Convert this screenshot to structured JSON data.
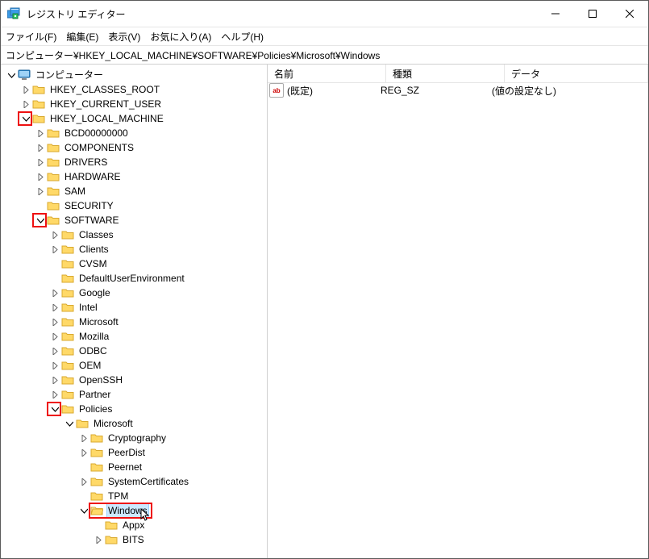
{
  "window": {
    "title": "レジストリ エディター"
  },
  "menu": {
    "file": "ファイル(F)",
    "edit": "編集(E)",
    "view": "表示(V)",
    "favorites": "お気に入り(A)",
    "help": "ヘルプ(H)"
  },
  "address": "コンピューター¥HKEY_LOCAL_MACHINE¥SOFTWARE¥Policies¥Microsoft¥Windows",
  "tree": {
    "root": "コンピューター",
    "hkcr": "HKEY_CLASSES_ROOT",
    "hkcu": "HKEY_CURRENT_USER",
    "hklm": "HKEY_LOCAL_MACHINE",
    "bcd": "BCD00000000",
    "components": "COMPONENTS",
    "drivers": "DRIVERS",
    "hardware": "HARDWARE",
    "sam": "SAM",
    "security": "SECURITY",
    "software": "SOFTWARE",
    "classes": "Classes",
    "clients": "Clients",
    "cvsm": "CVSM",
    "due": "DefaultUserEnvironment",
    "google": "Google",
    "intel": "Intel",
    "microsoft": "Microsoft",
    "mozilla": "Mozilla",
    "odbc": "ODBC",
    "oem": "OEM",
    "openssh": "OpenSSH",
    "partner": "Partner",
    "policies": "Policies",
    "ms2": "Microsoft",
    "crypto": "Cryptography",
    "peerdist": "PeerDist",
    "peernet": "Peernet",
    "syscert": "SystemCertificates",
    "tpm": "TPM",
    "windows": "Windows",
    "appx": "Appx",
    "bits": "BITS"
  },
  "list": {
    "headers": {
      "name": "名前",
      "type": "種類",
      "data": "データ"
    },
    "rows": [
      {
        "name": "(既定)",
        "type": "REG_SZ",
        "data": "(値の設定なし)"
      }
    ]
  }
}
